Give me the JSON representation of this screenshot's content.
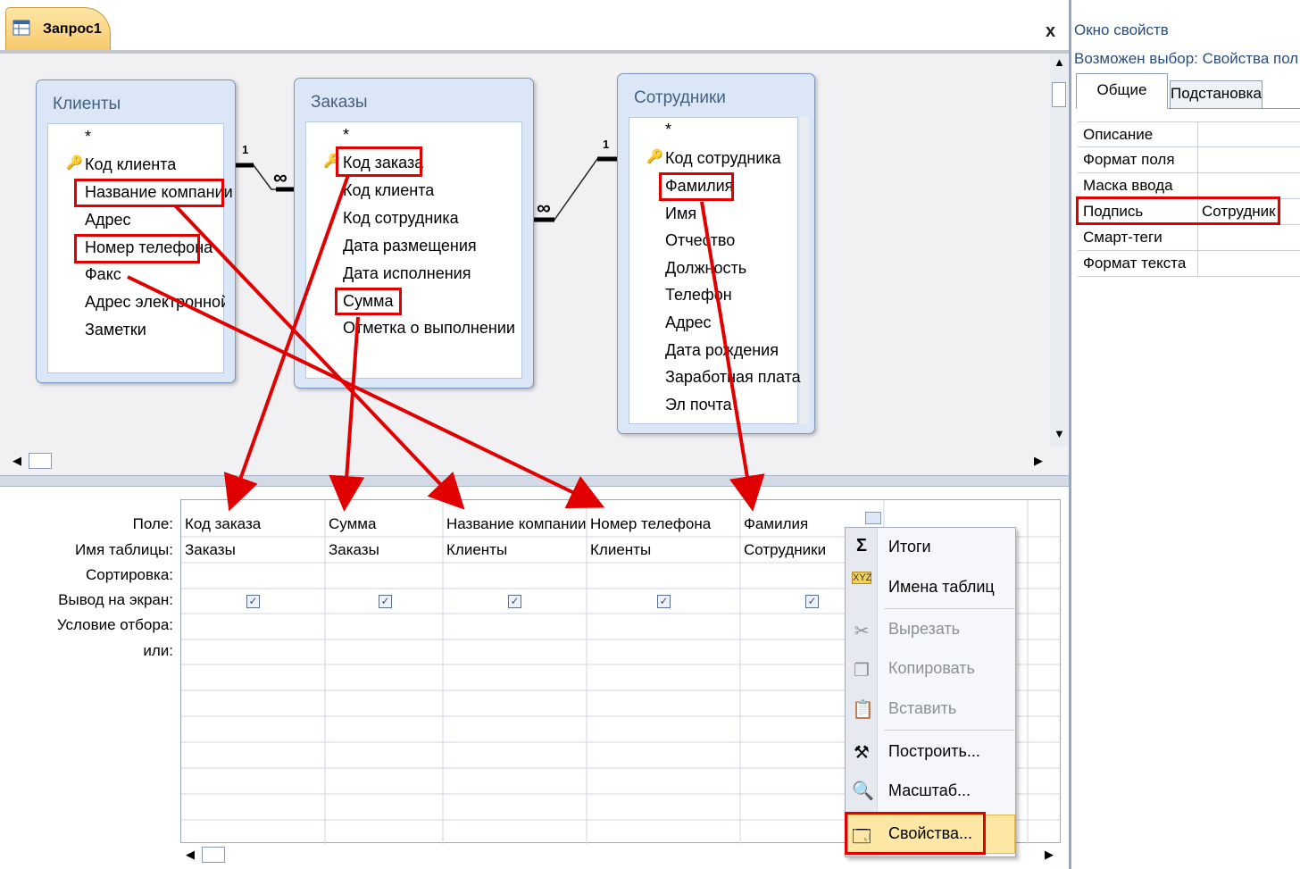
{
  "query_tab": {
    "title": "Запрос1",
    "close": "x"
  },
  "tables": [
    {
      "name": "Клиенты",
      "fields": [
        "*",
        "Код клиента",
        "Название компании",
        "Адрес",
        "Номер телефона",
        "Факс",
        "Адрес электронной г",
        "Заметки"
      ],
      "relation_left": "",
      "relation_right": "1"
    },
    {
      "name": "Заказы",
      "fields": [
        "*",
        "Код заказа",
        "Код клиента",
        "Код сотрудника",
        "Дата размещения",
        "Дата исполнения",
        "Сумма",
        "Отметка о выполнении"
      ],
      "relation_left": "∞",
      "relation_right": "∞"
    },
    {
      "name": "Сотрудники",
      "fields": [
        "*",
        "Код сотрудника",
        "Фамилия",
        "Имя",
        "Отчество",
        "Должность",
        "Телефон",
        "Адрес",
        "Дата рождения",
        "Заработная плата",
        "Эл почта"
      ],
      "relation_left": "1"
    }
  ],
  "grid": {
    "row_labels": [
      "Поле:",
      "Имя таблицы:",
      "Сортировка:",
      "Вывод на экран:",
      "Условие отбора:",
      "или:"
    ],
    "columns": [
      {
        "field": "Код заказа",
        "table": "Заказы",
        "show": true
      },
      {
        "field": "Сумма",
        "table": "Заказы",
        "show": true
      },
      {
        "field": "Название компании",
        "table": "Клиенты",
        "show": true
      },
      {
        "field": "Номер телефона",
        "table": "Клиенты",
        "show": true
      },
      {
        "field": "Фамилия",
        "table": "Сотрудники",
        "show": true
      }
    ]
  },
  "properties": {
    "title": "Окно свойств",
    "selection": "Возможен выбор:  Свойства поля",
    "tabs": [
      "Общие",
      "Подстановка"
    ],
    "rows": [
      {
        "name": "Описание",
        "value": ""
      },
      {
        "name": "Формат поля",
        "value": ""
      },
      {
        "name": "Маска ввода",
        "value": ""
      },
      {
        "name": "Подпись",
        "value": "Сотрудник"
      },
      {
        "name": "Смарт-теги",
        "value": ""
      },
      {
        "name": "Формат текста",
        "value": ""
      }
    ]
  },
  "context_menu": {
    "items": [
      {
        "label": "Итоги",
        "icon": "sigma-icon",
        "enabled": true
      },
      {
        "label": "Имена таблиц",
        "icon": "table-names-icon",
        "enabled": true
      },
      {
        "label": "Вырезать",
        "icon": "scissors-icon",
        "enabled": false
      },
      {
        "label": "Копировать",
        "icon": "copy-icon",
        "enabled": false
      },
      {
        "label": "Вставить",
        "icon": "paste-icon",
        "enabled": false
      },
      {
        "label": "Построить...",
        "icon": "build-wand-icon",
        "enabled": true
      },
      {
        "label": "Масштаб...",
        "icon": "zoom-icon",
        "enabled": true
      },
      {
        "label": "Свойства...",
        "icon": "properties-icon",
        "enabled": true,
        "highlighted": true
      }
    ]
  },
  "colors": {
    "annotation_red": "#e00000",
    "tab_gold": "#f8c96c",
    "table_header_text": "#44617f"
  }
}
